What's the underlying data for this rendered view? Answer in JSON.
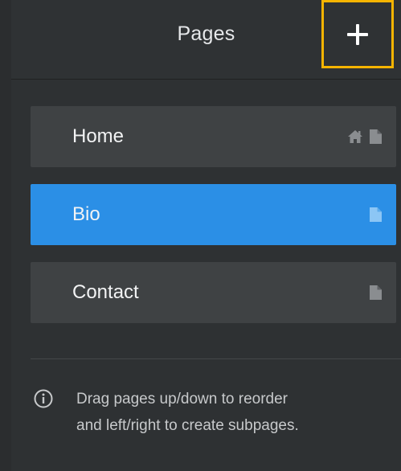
{
  "header": {
    "title": "Pages",
    "add_button_icon": "plus-icon"
  },
  "pages": [
    {
      "label": "Home",
      "selected": false,
      "icons": [
        "home-icon",
        "page-icon"
      ]
    },
    {
      "label": "Bio",
      "selected": true,
      "icons": [
        "page-icon"
      ]
    },
    {
      "label": "Contact",
      "selected": false,
      "icons": [
        "page-icon"
      ]
    }
  ],
  "hint": {
    "icon": "info-icon",
    "line1": "Drag pages up/down to reorder",
    "line2": "and left/right to create subpages."
  },
  "colors": {
    "background": "#2e3133",
    "item": "#3f4244",
    "selected": "#2b8fe6",
    "highlight": "#f6b400"
  }
}
